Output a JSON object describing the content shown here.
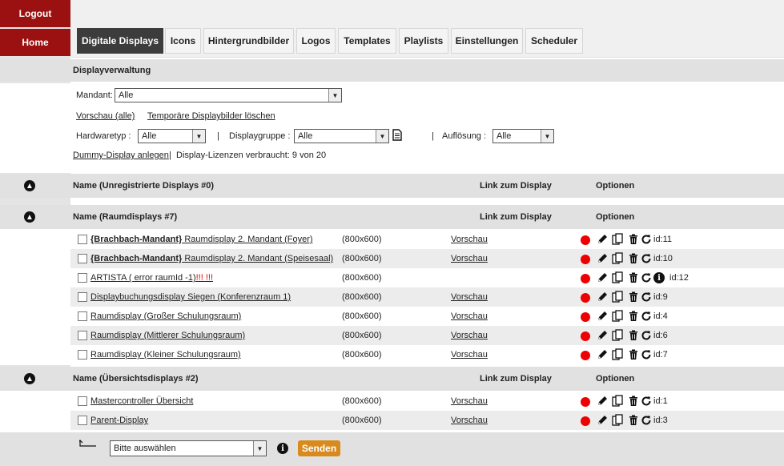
{
  "sidebar": {
    "logout": "Logout",
    "home": "Home"
  },
  "tabs": [
    "Digitale Displays",
    "Icons",
    "Hintergrundbilder",
    "Logos",
    "Templates",
    "Playlists",
    "Einstellungen",
    "Scheduler"
  ],
  "section_title": "Displayverwaltung",
  "filters": {
    "mandant_label": "Mandant:",
    "mandant_value": "Alle",
    "vorschau_alle": "Vorschau (alle)",
    "temp_delete": "Temporäre Displaybilder löschen",
    "hardwaretyp_label": "Hardwaretyp :",
    "hardwaretyp_value": "Alle",
    "sep": "|",
    "displaygruppe_label": "Displaygruppe :",
    "displaygruppe_value": "Alle",
    "aufloesung_label": "Auflösung :",
    "aufloesung_value": "Alle",
    "dummy_link": "Dummy-Display anlegen",
    "licenses": "Display-Lizenzen verbraucht: 9 von 20"
  },
  "groups": {
    "unregistered": "Name (Unregistrierte Displays #0)",
    "raum": "Name (Raumdisplays #7)",
    "uebersicht": "Name (Übersichtsdisplays #2)"
  },
  "col_link": "Link zum Display",
  "col_options": "Optionen",
  "rows": [
    {
      "bold": "{Brachbach-Mandant}",
      "name": " Raumdisplay 2. Mandant (Foyer)",
      "err": "",
      "res": "(800x600)",
      "link": "Vorschau",
      "id": "id:11"
    },
    {
      "bold": "{Brachbach-Mandant}",
      "name": " Raumdisplay 2. Mandant (Speisesaal)",
      "err": "",
      "res": "(800x600)",
      "link": "Vorschau",
      "id": "id:10"
    },
    {
      "bold": "",
      "name": "ARTISTA ( error raumId -1)",
      "err": "!!! !!!",
      "res": "(800x600)",
      "link": "",
      "id": "id:12"
    },
    {
      "bold": "",
      "name": "Displaybuchungsdisplay Siegen (Konferenzraum 1)",
      "err": "",
      "res": "(800x600)",
      "link": "Vorschau",
      "id": "id:9"
    },
    {
      "bold": "",
      "name": "Raumdisplay (Großer Schulungsraum)",
      "err": "",
      "res": "(800x600)",
      "link": "Vorschau",
      "id": "id:4"
    },
    {
      "bold": "",
      "name": "Raumdisplay (Mittlerer Schulungsraum)",
      "err": "",
      "res": "(800x600)",
      "link": "Vorschau",
      "id": "id:6"
    },
    {
      "bold": "",
      "name": "Raumdisplay (Kleiner Schulungsraum)",
      "err": "",
      "res": "(800x600)",
      "link": "Vorschau",
      "id": "id:7"
    },
    {
      "bold": "",
      "name": "Mastercontroller Übersicht",
      "err": "",
      "res": "(800x600)",
      "link": "Vorschau",
      "id": "id:1"
    },
    {
      "bold": "",
      "name": "Parent-Display",
      "err": "",
      "res": "(800x600)",
      "link": "Vorschau",
      "id": "id:3"
    }
  ],
  "bottom": {
    "select": "Bitte auswählen",
    "send": "Senden"
  },
  "colors": {
    "brand": "#9b1111",
    "status_red": "#ee0000",
    "send": "#d88a1c"
  }
}
